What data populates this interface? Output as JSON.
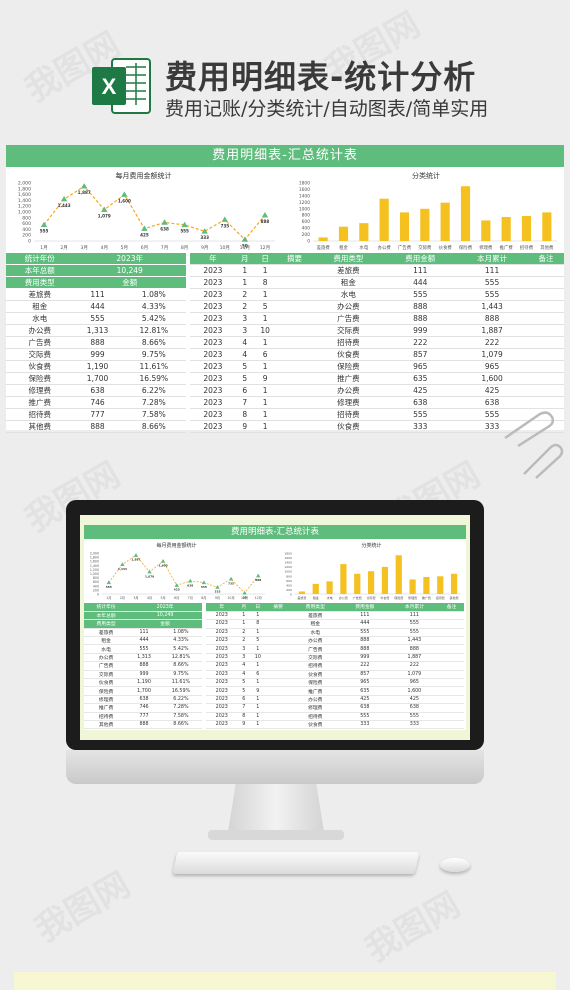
{
  "header": {
    "title": "费用明细表-统计分析",
    "subtitle": "费用记账/分类统计/自动图表/简单实用",
    "logo_letter": "X"
  },
  "sheet": {
    "title": "费用明细表-汇总统计表",
    "line_chart_title": "每月费用金额统计",
    "bar_chart_title": "分类统计",
    "left_table": {
      "rows_top": [
        [
          "统计年份",
          "2023年"
        ],
        [
          "本年总额",
          "10,249"
        ],
        [
          "费用类型",
          "金额"
        ]
      ],
      "rows": [
        [
          "差旅费",
          "111",
          "1.08%"
        ],
        [
          "租金",
          "444",
          "4.33%"
        ],
        [
          "水电",
          "555",
          "5.42%"
        ],
        [
          "办公费",
          "1,313",
          "12.81%"
        ],
        [
          "广告费",
          "888",
          "8.66%"
        ],
        [
          "交际费",
          "999",
          "9.75%"
        ],
        [
          "伙食费",
          "1,190",
          "11.61%"
        ],
        [
          "保险费",
          "1,700",
          "16.59%"
        ],
        [
          "修理费",
          "638",
          "6.22%"
        ],
        [
          "推广费",
          "746",
          "7.28%"
        ],
        [
          "招待费",
          "777",
          "7.58%"
        ],
        [
          "其他费",
          "888",
          "8.66%"
        ]
      ]
    },
    "right_table": {
      "headers": [
        "年",
        "月",
        "日",
        "摘要",
        "费用类型",
        "费用金额",
        "本月累计",
        "备注"
      ],
      "rows": [
        [
          "2023",
          "1",
          "1",
          "",
          "差旅费",
          "111",
          "111",
          ""
        ],
        [
          "2023",
          "1",
          "8",
          "",
          "租金",
          "444",
          "555",
          ""
        ],
        [
          "2023",
          "2",
          "1",
          "",
          "水电",
          "555",
          "555",
          ""
        ],
        [
          "2023",
          "2",
          "5",
          "",
          "办公费",
          "888",
          "1,443",
          ""
        ],
        [
          "2023",
          "3",
          "1",
          "",
          "广告费",
          "888",
          "888",
          ""
        ],
        [
          "2023",
          "3",
          "10",
          "",
          "交际费",
          "999",
          "1,887",
          ""
        ],
        [
          "2023",
          "4",
          "1",
          "",
          "招待费",
          "222",
          "222",
          ""
        ],
        [
          "2023",
          "4",
          "6",
          "",
          "伙食费",
          "857",
          "1,079",
          ""
        ],
        [
          "2023",
          "5",
          "1",
          "",
          "保险费",
          "965",
          "965",
          ""
        ],
        [
          "2023",
          "5",
          "9",
          "",
          "推广费",
          "635",
          "1,600",
          ""
        ],
        [
          "2023",
          "6",
          "1",
          "",
          "办公费",
          "425",
          "425",
          ""
        ],
        [
          "2023",
          "7",
          "1",
          "",
          "修理费",
          "638",
          "638",
          ""
        ],
        [
          "2023",
          "8",
          "1",
          "",
          "招待费",
          "555",
          "555",
          ""
        ],
        [
          "2023",
          "9",
          "1",
          "",
          "伙食费",
          "333",
          "333",
          ""
        ]
      ]
    }
  },
  "mini": {
    "left_rows": [
      [
        "差旅费",
        "111",
        "1.08%"
      ],
      [
        "租金",
        "444",
        "4.33%"
      ],
      [
        "水电",
        "555",
        "5.42%"
      ],
      [
        "办公费",
        "1,313",
        "12.81%"
      ],
      [
        "广告费",
        "888",
        "8.66%"
      ],
      [
        "交际费",
        "999",
        "9.75%"
      ],
      [
        "伙食费",
        "1,190",
        "11.61%"
      ],
      [
        "保险费",
        "1,700",
        "16.59%"
      ],
      [
        "修理费",
        "638",
        "6.22%"
      ],
      [
        "推广费",
        "746",
        "7.28%"
      ],
      [
        "招待费",
        "777",
        "7.58%"
      ],
      [
        "其他费",
        "888",
        "8.66%"
      ]
    ],
    "right_rows": [
      [
        "2023",
        "1",
        "1",
        "",
        "差旅费",
        "111",
        "111",
        ""
      ],
      [
        "2023",
        "1",
        "8",
        "",
        "租金",
        "444",
        "555",
        ""
      ],
      [
        "2023",
        "2",
        "1",
        "",
        "水电",
        "555",
        "555",
        ""
      ],
      [
        "2023",
        "2",
        "5",
        "",
        "办公费",
        "888",
        "1,443",
        ""
      ],
      [
        "2023",
        "3",
        "1",
        "",
        "广告费",
        "888",
        "888",
        ""
      ],
      [
        "2023",
        "3",
        "10",
        "",
        "交际费",
        "999",
        "1,887",
        ""
      ],
      [
        "2023",
        "4",
        "1",
        "",
        "招待费",
        "222",
        "222",
        ""
      ],
      [
        "2023",
        "4",
        "6",
        "",
        "伙食费",
        "857",
        "1,079",
        ""
      ],
      [
        "2023",
        "5",
        "1",
        "",
        "保险费",
        "965",
        "965",
        ""
      ],
      [
        "2023",
        "5",
        "9",
        "",
        "推广费",
        "635",
        "1,600",
        ""
      ],
      [
        "2023",
        "6",
        "1",
        "",
        "办公费",
        "425",
        "425",
        ""
      ],
      [
        "2023",
        "7",
        "1",
        "",
        "修理费",
        "638",
        "638",
        ""
      ],
      [
        "2023",
        "8",
        "1",
        "",
        "招待费",
        "555",
        "555",
        ""
      ],
      [
        "2023",
        "9",
        "1",
        "",
        "伙食费",
        "333",
        "333",
        ""
      ]
    ]
  },
  "chart_data": [
    {
      "type": "line",
      "title": "每月费用金额统计",
      "categories": [
        "1月",
        "2月",
        "3月",
        "4月",
        "5月",
        "6月",
        "7月",
        "8月",
        "9月",
        "10月",
        "11月",
        "12月"
      ],
      "values": [
        555,
        1443,
        1887,
        1079,
        1600,
        425,
        638,
        555,
        333,
        735,
        50,
        888
      ],
      "ylim": [
        0,
        2000
      ],
      "yticks": [
        "0",
        "200",
        "400",
        "600",
        "800",
        "1,000",
        "1,200",
        "1,400",
        "1,600",
        "1,800",
        "2,000"
      ],
      "color": "#f5a623",
      "marker_color": "#5ebc7c"
    },
    {
      "type": "bar",
      "title": "分类统计",
      "categories": [
        "差旅费",
        "租金",
        "水电",
        "办公费",
        "广告费",
        "交际费",
        "伙食费",
        "保险费",
        "修理费",
        "推广费",
        "招待费",
        "其他费"
      ],
      "values": [
        111,
        444,
        555,
        1313,
        888,
        999,
        1190,
        1700,
        638,
        746,
        777,
        888
      ],
      "ylim": [
        0,
        1800
      ],
      "yticks": [
        "0",
        "200",
        "400",
        "600",
        "800",
        "1000",
        "1200",
        "1400",
        "1600",
        "1800"
      ],
      "color": "#f5c120"
    }
  ],
  "colors": {
    "accent_green": "#5ebc7c",
    "line_orange": "#f5a623",
    "bar_yellow": "#f5c120"
  },
  "watermark": "我图网"
}
